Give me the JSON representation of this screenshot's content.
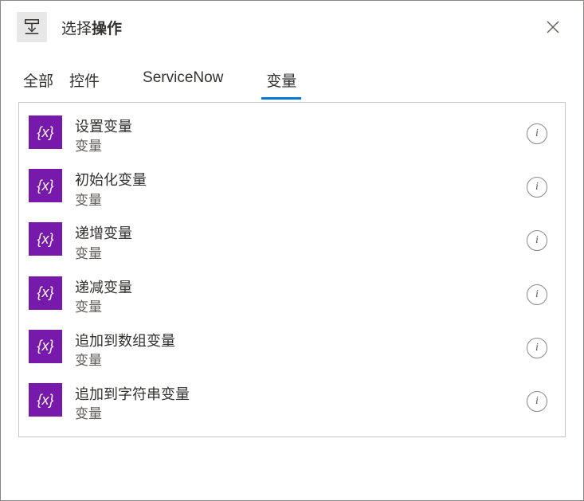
{
  "header": {
    "title_prefix": "选择",
    "title_bold": "操作"
  },
  "tabs": [
    {
      "label": "全部",
      "active": false,
      "kind": "normal"
    },
    {
      "label": "控件",
      "active": false,
      "kind": "normal"
    },
    {
      "label": "ServiceNow",
      "active": false,
      "kind": "wide"
    },
    {
      "label": "变量",
      "active": true,
      "kind": "normal"
    }
  ],
  "actions": [
    {
      "title": "设置变量",
      "subtitle": "变量",
      "icon_text": "{x}"
    },
    {
      "title": "初始化变量",
      "subtitle": "变量",
      "icon_text": "{x}"
    },
    {
      "title": "递增变量",
      "subtitle": "变量",
      "icon_text": "{x}"
    },
    {
      "title": "递减变量",
      "subtitle": "变量",
      "icon_text": "{x}"
    },
    {
      "title": "追加到数组变量",
      "subtitle": "变量",
      "icon_text": "{x}"
    },
    {
      "title": "追加到字符串变量",
      "subtitle": "变量",
      "icon_text": "{x}"
    }
  ],
  "colors": {
    "accent": "#0078d4",
    "variable_icon_bg": "#7719aa"
  }
}
